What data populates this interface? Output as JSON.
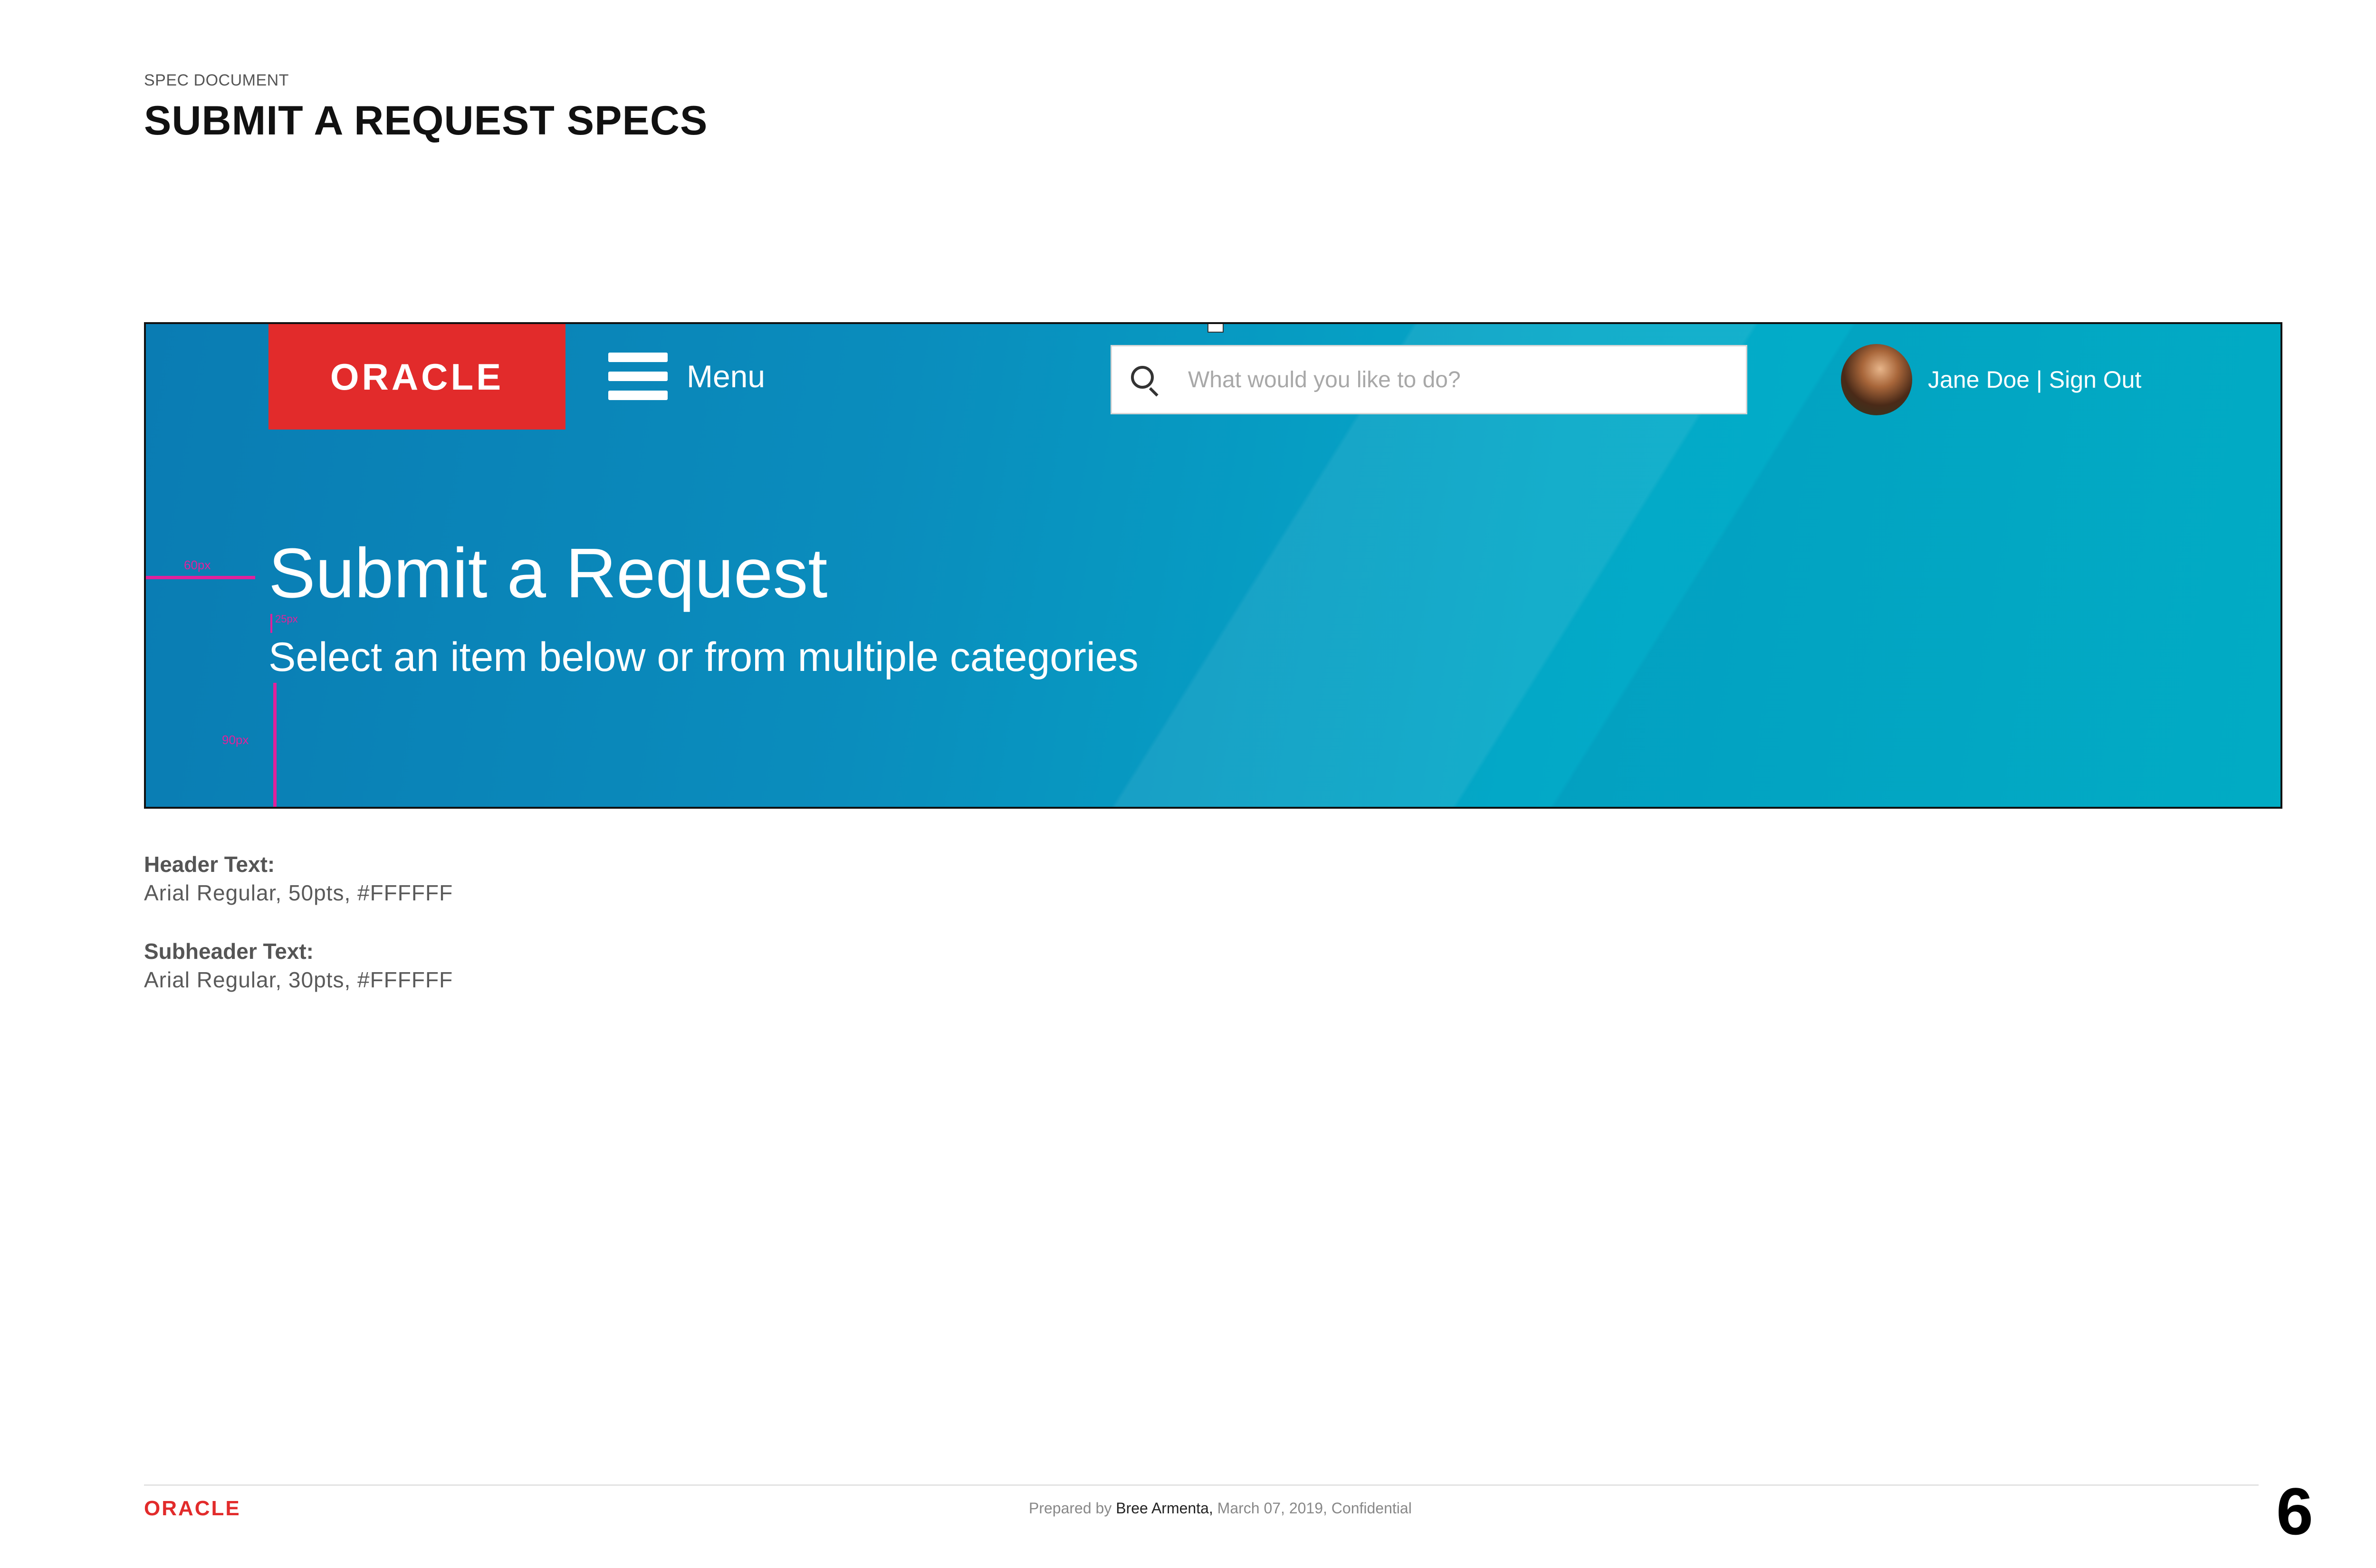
{
  "document": {
    "label": "SPEC DOCUMENT",
    "title": "SUBMIT A REQUEST SPECS"
  },
  "banner": {
    "logo_text": "ORACLE",
    "menu_label": "Menu",
    "search_placeholder": "What would you like to do?",
    "user_text": "Jane Doe | Sign Out",
    "title": "Submit a Request",
    "subtitle": "Select an item below or from multiple categories",
    "gradient_colors": [
      "#0a7cb3",
      "#01b5cb"
    ],
    "logo_bg_color": "#e22b2b",
    "annotations": {
      "left_margin": "60px",
      "title_gap": "25px",
      "bottom_padding": "90px",
      "color": "#e0219c"
    }
  },
  "specs": [
    {
      "key": "Header Text:",
      "value": "Arial Regular, 50pts, #FFFFFF"
    },
    {
      "key": "Subheader Text:",
      "value": "Arial Regular, 30pts, #FFFFFF"
    }
  ],
  "footer": {
    "logo_text": "ORACLE",
    "prepared_prefix": "Prepared by",
    "author": "Bree Armenta,",
    "date_note": "March 07, 2019, Confidential",
    "page_number": "6"
  }
}
